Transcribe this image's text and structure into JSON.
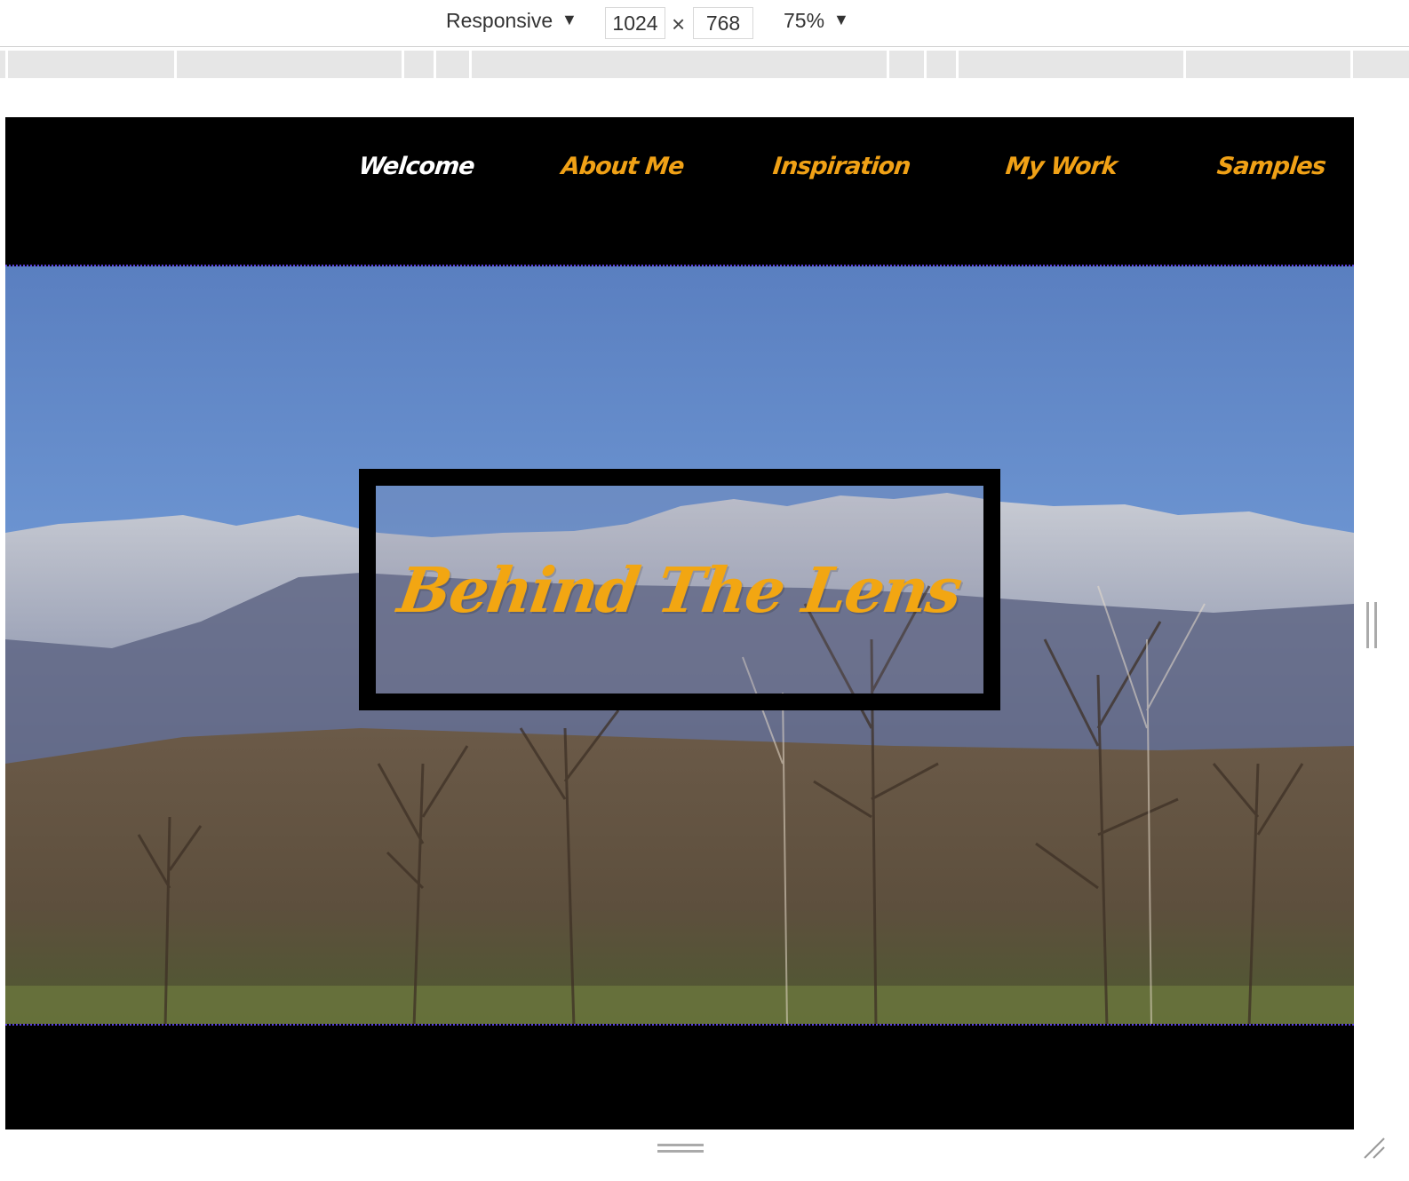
{
  "toolbar": {
    "device": "Responsive",
    "width": "1024",
    "height": "768",
    "separator": "×",
    "zoom": "75%"
  },
  "nav": {
    "items": [
      {
        "label": "Welcome",
        "active": true
      },
      {
        "label": "About Me",
        "active": false
      },
      {
        "label": "Inspiration",
        "active": false
      },
      {
        "label": "My Work",
        "active": false
      },
      {
        "label": "Samples",
        "active": false
      }
    ]
  },
  "hero": {
    "title": "Behind The Lens"
  },
  "colors": {
    "accent": "#f0a116",
    "nav_active": "#ffffff",
    "background": "#000000"
  }
}
